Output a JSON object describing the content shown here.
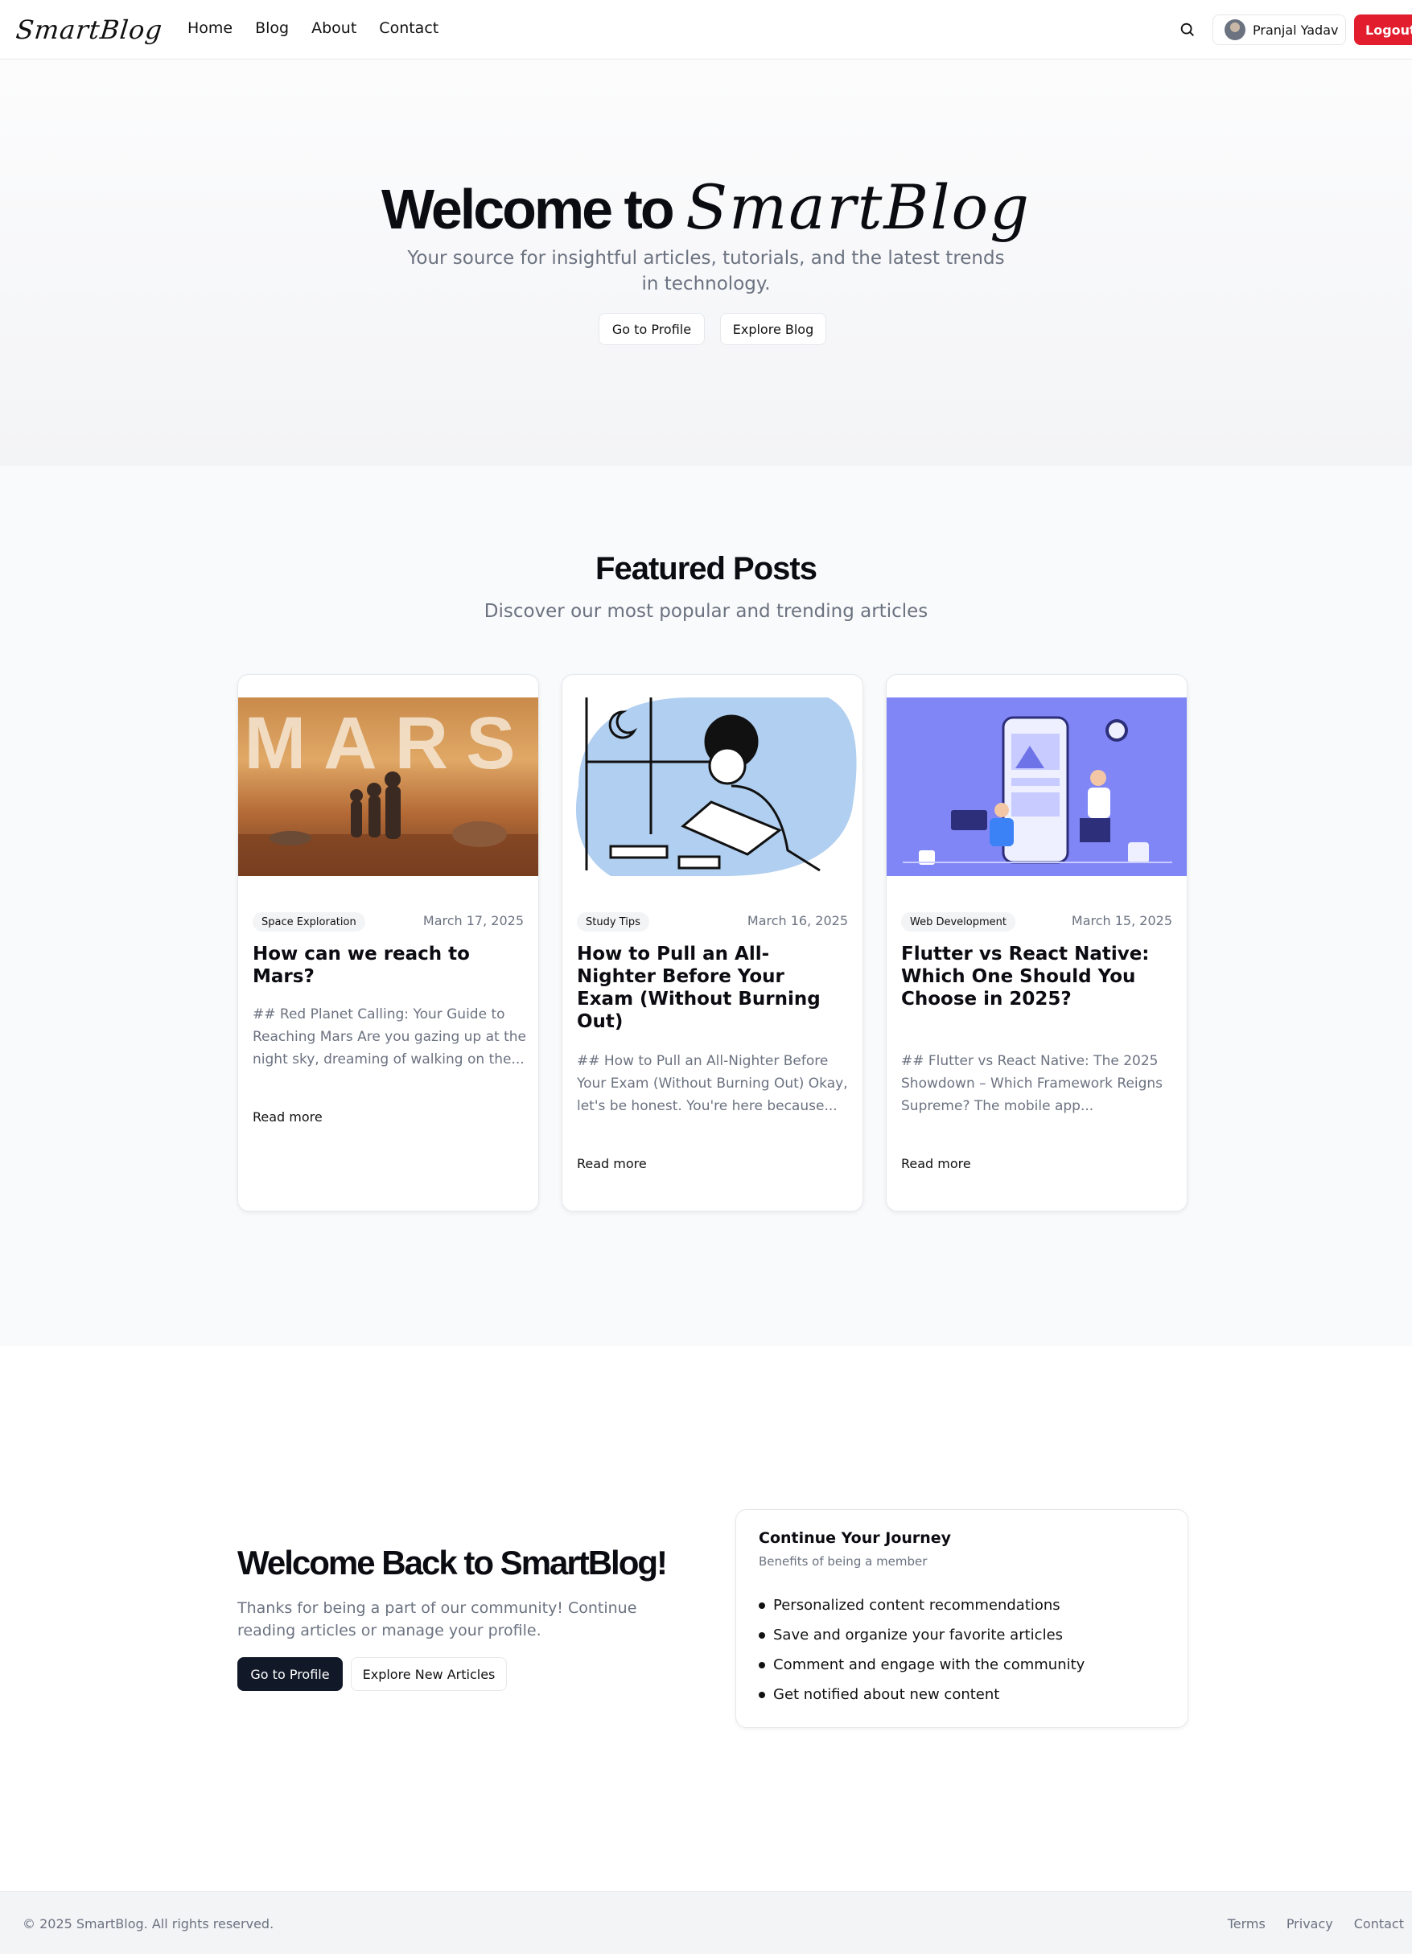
{
  "nav": {
    "logo": "SmartBlog",
    "menu": [
      "Home",
      "Blog",
      "About",
      "Contact"
    ],
    "search_icon": "search-icon",
    "user_name": "Pranjal Yadav",
    "logout_label": "Logout"
  },
  "hero": {
    "title_prefix": "Welcome to",
    "title_brand": "SmartBlog",
    "subtitle": "Your source for insightful articles, tutorials, and the latest trends in technology.",
    "profile_button": "Go to Profile",
    "blog_button": "Explore Blog"
  },
  "featured": {
    "title": "Featured Posts",
    "subtitle": "Discover our most popular and trending articles",
    "posts": [
      {
        "category": "Space Exploration",
        "date": "March 17, 2025",
        "title": "How can we reach to Mars?",
        "excerpt": "## Red Planet Calling: Your Guide to Reaching Mars Are you gazing up at the night sky, dreaming of walking on the...",
        "read_more": "Read more",
        "image_text": "MARS"
      },
      {
        "category": "Study Tips",
        "date": "March 16, 2025",
        "title": "How to Pull an All-Nighter Before Your Exam (Without Burning Out)",
        "excerpt": "## How to Pull an All-Nighter Before Your Exam (Without Burning Out) Okay, let's be honest. You're here because...",
        "read_more": "Read more"
      },
      {
        "category": "Web Development",
        "date": "March 15, 2025",
        "title": "Flutter vs React Native: Which One Should You Choose in 2025?",
        "excerpt": "## Flutter vs React Native: The 2025 Showdown – Which Framework Reigns Supreme? The mobile app...",
        "read_more": "Read more"
      }
    ]
  },
  "welcome": {
    "title": "Welcome Back to SmartBlog!",
    "text": "Thanks for being a part of our community! Continue reading articles or manage your profile.",
    "profile_button": "Go to Profile",
    "explore_button": "Explore New Articles",
    "journey_title": "Continue Your Journey",
    "journey_subtitle": "Benefits of being a member",
    "benefits": [
      "Personalized content recommendations",
      "Save and organize your favorite articles",
      "Comment and engage with the community",
      "Get notified about new content"
    ]
  },
  "footer": {
    "copyright": "© 2025 SmartBlog. All rights reserved.",
    "links": [
      "Terms",
      "Privacy",
      "Contact"
    ]
  },
  "colors": {
    "logout": "#e11d2e",
    "primary_dark": "#111827",
    "muted_text": "#6b7280"
  }
}
